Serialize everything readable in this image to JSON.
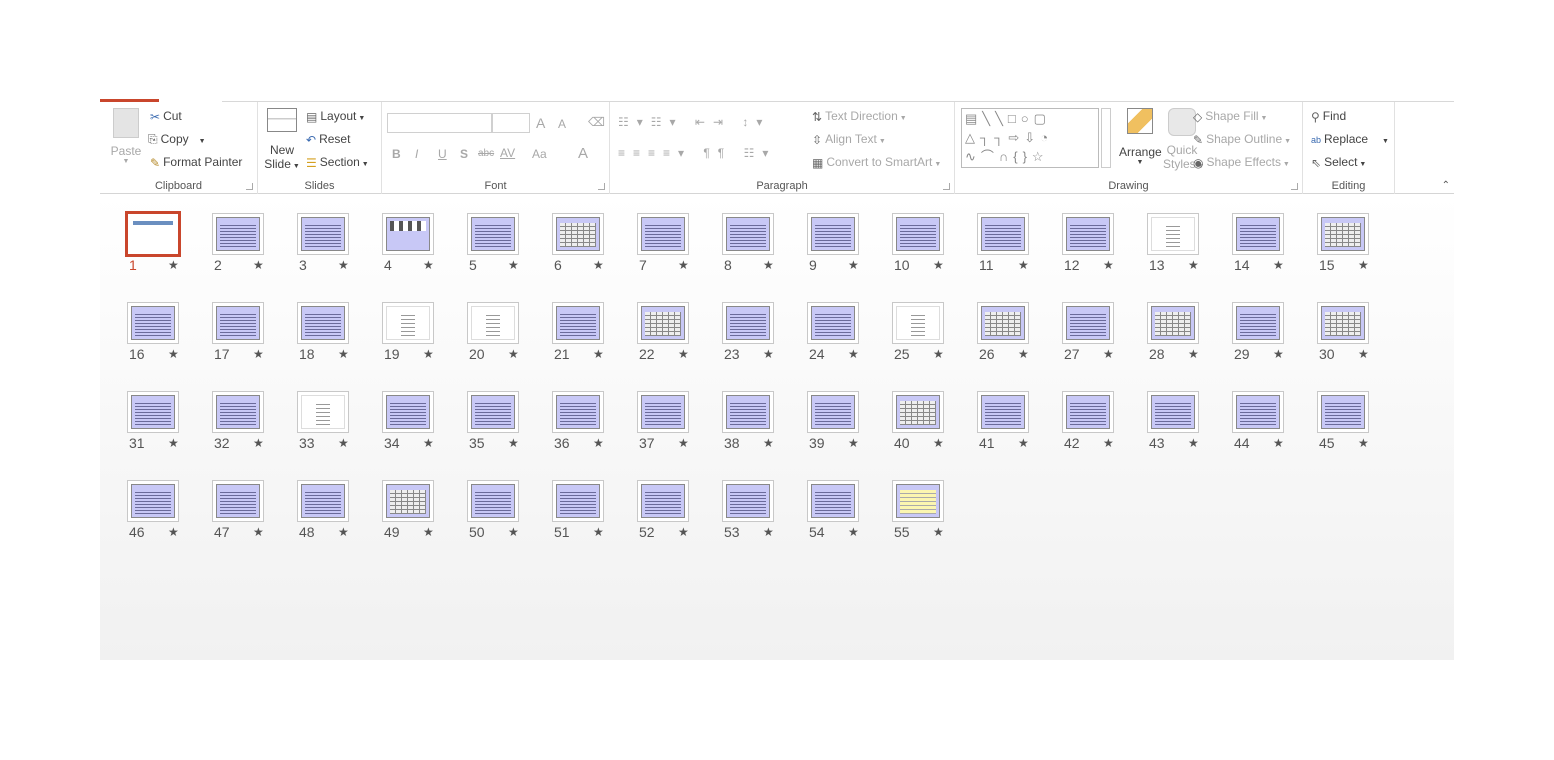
{
  "ribbon": {
    "clipboard": {
      "label": "Clipboard",
      "paste": "Paste",
      "cut": "Cut",
      "copy": "Copy",
      "format_painter": "Format Painter"
    },
    "slides": {
      "label": "Slides",
      "new_slide_1": "New",
      "new_slide_2": "Slide",
      "layout": "Layout",
      "reset": "Reset",
      "section": "Section"
    },
    "font": {
      "label": "Font",
      "font_name": "",
      "font_size": "",
      "grow": "A",
      "shrink": "A",
      "bold": "B",
      "italic": "I",
      "underline": "U",
      "shadow": "S",
      "strike": "abc",
      "spacing": "AV",
      "case": "Aa",
      "color": "A"
    },
    "paragraph": {
      "label": "Paragraph",
      "text_direction": "Text Direction",
      "align_text": "Align Text",
      "smartart": "Convert to SmartArt"
    },
    "drawing": {
      "label": "Drawing",
      "arrange": "Arrange",
      "quick_styles_1": "Quick",
      "quick_styles_2": "Styles",
      "shape_fill": "Shape Fill",
      "shape_outline": "Shape Outline",
      "shape_effects": "Shape Effects"
    },
    "editing": {
      "label": "Editing",
      "find": "Find",
      "replace": "Replace",
      "select": "Select"
    }
  },
  "sorter": {
    "selected": 1,
    "accent_color": "#c9462c",
    "slides": [
      {
        "n": "1",
        "kind": "title"
      },
      {
        "n": "2",
        "kind": "text"
      },
      {
        "n": "3",
        "kind": "text"
      },
      {
        "n": "4",
        "kind": "image"
      },
      {
        "n": "5",
        "kind": "text"
      },
      {
        "n": "6",
        "kind": "table"
      },
      {
        "n": "7",
        "kind": "text"
      },
      {
        "n": "8",
        "kind": "text"
      },
      {
        "n": "9",
        "kind": "text"
      },
      {
        "n": "10",
        "kind": "text"
      },
      {
        "n": "11",
        "kind": "text"
      },
      {
        "n": "12",
        "kind": "text"
      },
      {
        "n": "13",
        "kind": "white"
      },
      {
        "n": "14",
        "kind": "text"
      },
      {
        "n": "15",
        "kind": "table"
      },
      {
        "n": "16",
        "kind": "text"
      },
      {
        "n": "17",
        "kind": "text"
      },
      {
        "n": "18",
        "kind": "text"
      },
      {
        "n": "19",
        "kind": "white"
      },
      {
        "n": "20",
        "kind": "white"
      },
      {
        "n": "21",
        "kind": "text"
      },
      {
        "n": "22",
        "kind": "table"
      },
      {
        "n": "23",
        "kind": "text"
      },
      {
        "n": "24",
        "kind": "text"
      },
      {
        "n": "25",
        "kind": "white"
      },
      {
        "n": "26",
        "kind": "table"
      },
      {
        "n": "27",
        "kind": "text"
      },
      {
        "n": "28",
        "kind": "table"
      },
      {
        "n": "29",
        "kind": "text"
      },
      {
        "n": "30",
        "kind": "table"
      },
      {
        "n": "31",
        "kind": "text"
      },
      {
        "n": "32",
        "kind": "text"
      },
      {
        "n": "33",
        "kind": "white"
      },
      {
        "n": "34",
        "kind": "text"
      },
      {
        "n": "35",
        "kind": "text"
      },
      {
        "n": "36",
        "kind": "text"
      },
      {
        "n": "37",
        "kind": "text"
      },
      {
        "n": "38",
        "kind": "text"
      },
      {
        "n": "39",
        "kind": "text"
      },
      {
        "n": "40",
        "kind": "table"
      },
      {
        "n": "41",
        "kind": "text"
      },
      {
        "n": "42",
        "kind": "text"
      },
      {
        "n": "43",
        "kind": "text"
      },
      {
        "n": "44",
        "kind": "text"
      },
      {
        "n": "45",
        "kind": "text"
      },
      {
        "n": "46",
        "kind": "text"
      },
      {
        "n": "47",
        "kind": "text"
      },
      {
        "n": "48",
        "kind": "text"
      },
      {
        "n": "49",
        "kind": "table"
      },
      {
        "n": "50",
        "kind": "text"
      },
      {
        "n": "51",
        "kind": "text"
      },
      {
        "n": "52",
        "kind": "text"
      },
      {
        "n": "53",
        "kind": "text"
      },
      {
        "n": "54",
        "kind": "text"
      },
      {
        "n": "55",
        "kind": "yellow"
      }
    ]
  }
}
